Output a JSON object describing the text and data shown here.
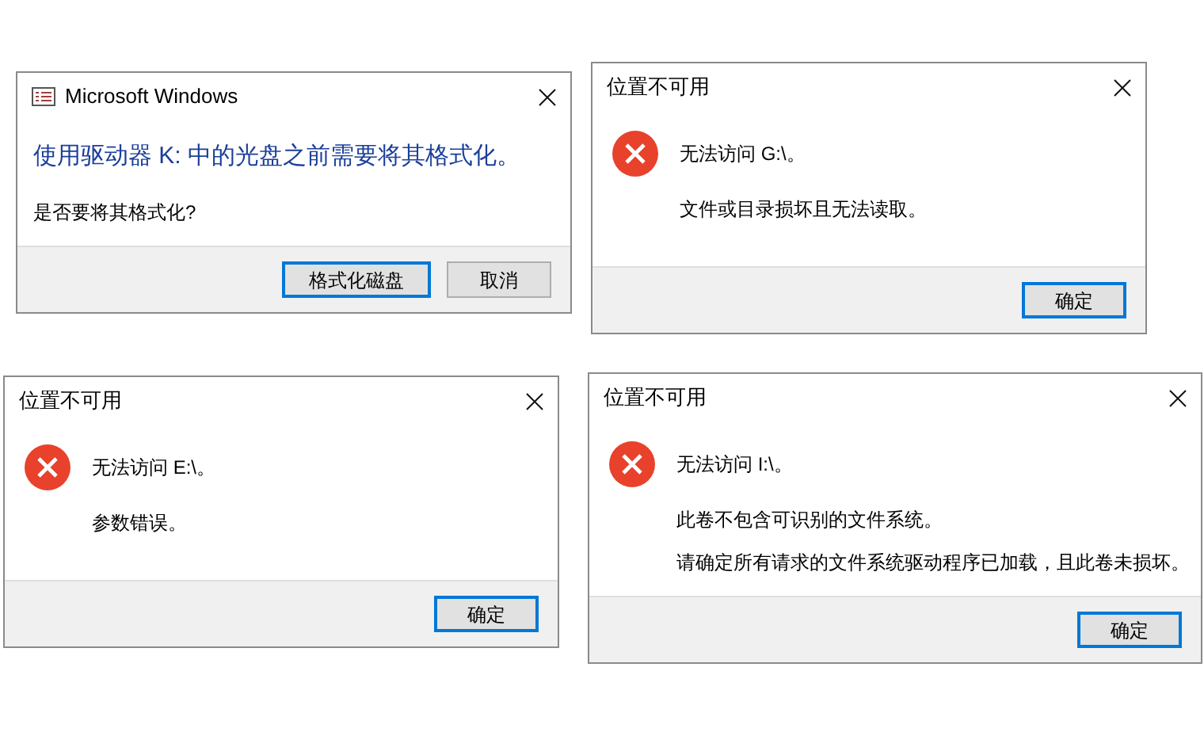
{
  "dialogs": [
    {
      "kind": "format",
      "title": "Microsoft Windows",
      "heading": "使用驱动器 K: 中的光盘之前需要将其格式化。",
      "messages": [
        "是否要将其格式化?"
      ],
      "buttons": [
        {
          "label": "格式化磁盘",
          "default": true
        },
        {
          "label": "取消",
          "default": false
        }
      ]
    },
    {
      "kind": "error",
      "title": "位置不可用",
      "heading": "无法访问 G:\\。",
      "messages": [
        "文件或目录损坏且无法读取。"
      ],
      "buttons": [
        {
          "label": "确定",
          "default": true
        }
      ]
    },
    {
      "kind": "error",
      "title": "位置不可用",
      "heading": "无法访问 E:\\。",
      "messages": [
        "参数错误。"
      ],
      "buttons": [
        {
          "label": "确定",
          "default": true
        }
      ]
    },
    {
      "kind": "error",
      "title": "位置不可用",
      "heading": "无法访问 I:\\。",
      "messages": [
        "此卷不包含可识别的文件系统。",
        "请确定所有请求的文件系统驱动程序已加载，且此卷未损坏。"
      ],
      "buttons": [
        {
          "label": "确定",
          "default": true
        }
      ]
    }
  ]
}
